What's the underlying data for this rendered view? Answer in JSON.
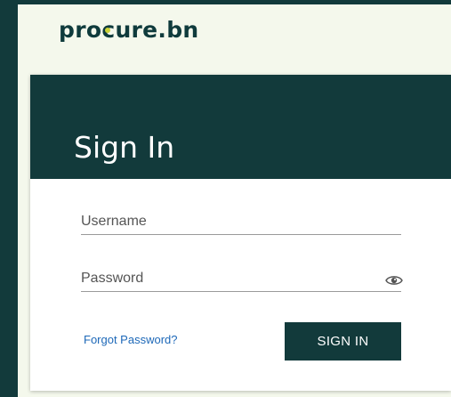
{
  "brand": {
    "logo_part1": "pro",
    "logo_part2": "c",
    "logo_part3": "ure.bn",
    "accent_color": "#cbd335",
    "primary_color": "#123a3b"
  },
  "login": {
    "title": "Sign In",
    "username_placeholder": "Username",
    "password_placeholder": "Password",
    "forgot_label": "Forgot Password?",
    "submit_label": "SIGN IN",
    "password_toggle_icon": "eye-icon"
  }
}
